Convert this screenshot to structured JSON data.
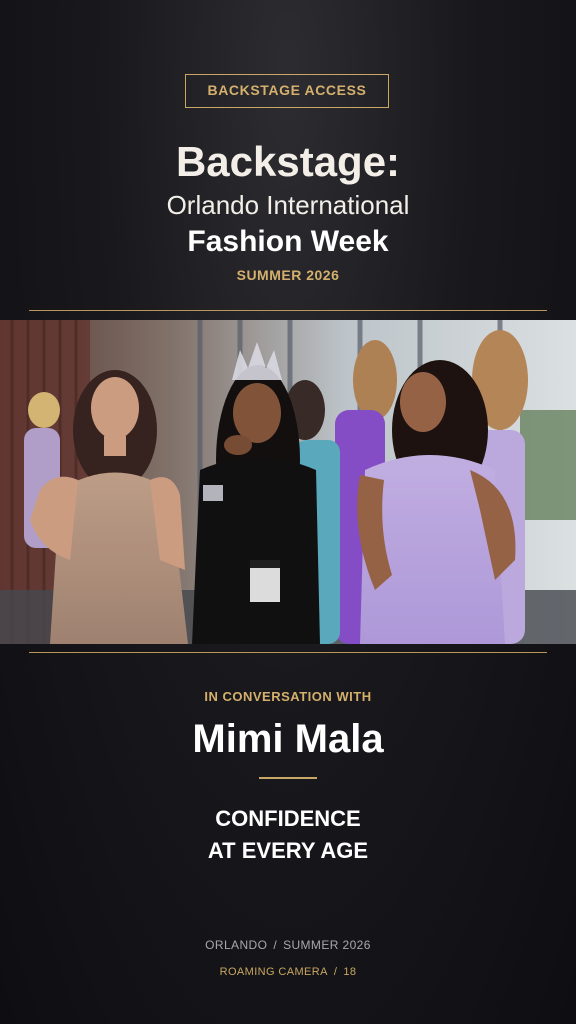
{
  "header": {
    "badge": "BACKSTAGE ACCESS",
    "title_line1": "Backstage:",
    "title_line2": "Orlando International",
    "title_line3": "Fashion Week",
    "season": "SUMMER 2026"
  },
  "feature": {
    "kicker": "IN CONVERSATION WITH",
    "guest_name": "Mimi Mala",
    "topic_line1": "CONFIDENCE",
    "topic_line2": "AT EVERY AGE"
  },
  "footer": {
    "location": "ORLANDO",
    "location_separator": "/",
    "season": "SUMMER 2026",
    "segment": "ROAMING CAMERA",
    "segment_separator": "/",
    "number": "18"
  },
  "colors": {
    "accent_gold": "#c9a765",
    "background": "#17171b",
    "text": "#ffffff"
  }
}
